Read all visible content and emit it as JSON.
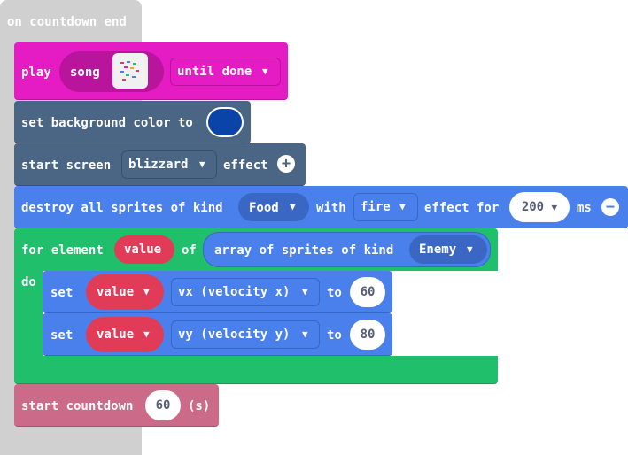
{
  "colors": {
    "hat": "#d0d0d0",
    "music": "#e51bc4",
    "music_dark": "#b8149c",
    "scene": "#4b6584",
    "scene_dark": "#3a5069",
    "sprites": "#4a80ec",
    "sprites_dark": "#3a66c4",
    "loops": "#20bf6b",
    "loops_dark": "#189955",
    "variable": "#e03c57",
    "info": "#cc6b89",
    "bg_color_swatch": "#0b44a8"
  },
  "hat": {
    "label": "on countdown end"
  },
  "play": {
    "label": "play",
    "song_label": "song",
    "mode": "until done"
  },
  "set_bg": {
    "label": "set background color to"
  },
  "start_screen": {
    "label": "start screen",
    "effect_name": "blizzard",
    "suffix": "effect"
  },
  "destroy": {
    "label": "destroy all sprites of kind",
    "kind": "Food",
    "with_label": "with",
    "effect": "fire",
    "effect_for": "effect for",
    "ms_value": "200",
    "ms_label": "ms"
  },
  "for_element": {
    "label": "for element",
    "var": "value",
    "of_label": "of",
    "array_label": "array of sprites of kind",
    "kind": "Enemy",
    "do_label": "do"
  },
  "set_vx": {
    "label": "set",
    "var": "value",
    "prop": "vx (velocity x)",
    "to_label": "to",
    "value": "60"
  },
  "set_vy": {
    "label": "set",
    "var": "value",
    "prop": "vy (velocity y)",
    "to_label": "to",
    "value": "80"
  },
  "countdown": {
    "label": "start countdown",
    "value": "60",
    "unit": "(s)"
  }
}
